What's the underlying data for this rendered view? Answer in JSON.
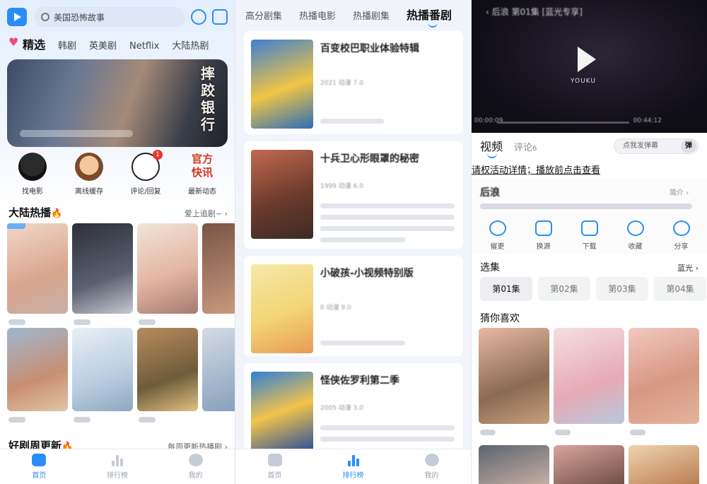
{
  "home": {
    "search_placeholder": "美国恐怖故事",
    "tabs": [
      "精选",
      "韩剧",
      "英美剧",
      "Netflix",
      "大陆热剧"
    ],
    "banner_title": "摔跤银行",
    "quick_links": [
      {
        "label": "找电影",
        "icon": "movie-mascot-icon"
      },
      {
        "label": "离线缓存",
        "icon": "cache-avatar-icon"
      },
      {
        "label": "评论/回复",
        "icon": "comment-icon",
        "badge": "1"
      },
      {
        "label": "最新动态",
        "icon": "news-icon",
        "art_text": "官方快讯"
      }
    ],
    "section1": {
      "title": "大陆热播",
      "more": "爱上追剧~"
    },
    "section2": {
      "title": "好剧周更新",
      "more": "每周更新热播剧"
    },
    "nav": [
      "首页",
      "排行榜",
      "我的"
    ]
  },
  "rank": {
    "tabs": [
      "高分剧集",
      "热播电影",
      "热播剧集",
      "热播番剧"
    ],
    "cards": [
      {
        "title": "百变校巴职业体验特辑",
        "meta": "2021 动漫 7.0"
      },
      {
        "title": "十兵卫心形眼罩的秘密",
        "meta": "1999 动漫 6.0"
      },
      {
        "title": "小破孩-小视频特别版",
        "meta": "0 动漫 9.0"
      },
      {
        "title": "怪侠佐罗利第二季",
        "meta": "2005 动漫 3.0"
      }
    ],
    "nav": [
      "首页",
      "排行榜",
      "我的"
    ]
  },
  "detail": {
    "player_title": "后浪 第01集 [蓝光专享]",
    "logo_text": "YOUKU",
    "time_current": "00:00:09",
    "time_total": "00:44:12",
    "tab_video": "视频",
    "tab_comment": "评论",
    "comment_count": "6",
    "danmaku_placeholder": "点我发弹幕",
    "danmaku_button": "弹",
    "notice": "请权活动详情；播放前点击查看",
    "show_name": "后浪",
    "intro_label": "简介",
    "actions": [
      {
        "label": "催更",
        "icon": "headphones-icon"
      },
      {
        "label": "换源",
        "icon": "switch-source-icon"
      },
      {
        "label": "下载",
        "icon": "download-icon"
      },
      {
        "label": "收藏",
        "icon": "heart-icon"
      },
      {
        "label": "分享",
        "icon": "share-icon"
      }
    ],
    "episodes_title": "选集",
    "quality": "蓝光",
    "episodes": [
      "第01集",
      "第02集",
      "第03集",
      "第04集"
    ],
    "recommend_title": "猜你喜欢"
  },
  "colors": {
    "accent": "#2a8df7",
    "fire": "#f2771c",
    "badge": "#e8342c"
  }
}
